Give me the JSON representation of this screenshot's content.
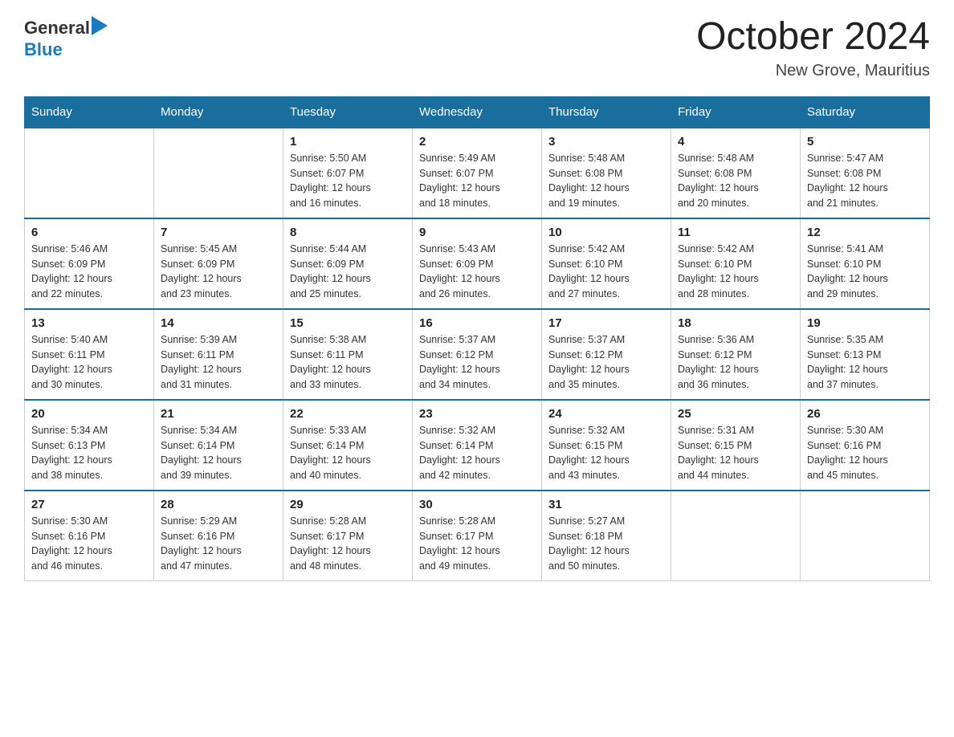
{
  "header": {
    "logo_general": "General",
    "logo_blue": "Blue",
    "month": "October 2024",
    "location": "New Grove, Mauritius"
  },
  "weekdays": [
    "Sunday",
    "Monday",
    "Tuesday",
    "Wednesday",
    "Thursday",
    "Friday",
    "Saturday"
  ],
  "weeks": [
    [
      {
        "day": "",
        "info": ""
      },
      {
        "day": "",
        "info": ""
      },
      {
        "day": "1",
        "info": "Sunrise: 5:50 AM\nSunset: 6:07 PM\nDaylight: 12 hours\nand 16 minutes."
      },
      {
        "day": "2",
        "info": "Sunrise: 5:49 AM\nSunset: 6:07 PM\nDaylight: 12 hours\nand 18 minutes."
      },
      {
        "day": "3",
        "info": "Sunrise: 5:48 AM\nSunset: 6:08 PM\nDaylight: 12 hours\nand 19 minutes."
      },
      {
        "day": "4",
        "info": "Sunrise: 5:48 AM\nSunset: 6:08 PM\nDaylight: 12 hours\nand 20 minutes."
      },
      {
        "day": "5",
        "info": "Sunrise: 5:47 AM\nSunset: 6:08 PM\nDaylight: 12 hours\nand 21 minutes."
      }
    ],
    [
      {
        "day": "6",
        "info": "Sunrise: 5:46 AM\nSunset: 6:09 PM\nDaylight: 12 hours\nand 22 minutes."
      },
      {
        "day": "7",
        "info": "Sunrise: 5:45 AM\nSunset: 6:09 PM\nDaylight: 12 hours\nand 23 minutes."
      },
      {
        "day": "8",
        "info": "Sunrise: 5:44 AM\nSunset: 6:09 PM\nDaylight: 12 hours\nand 25 minutes."
      },
      {
        "day": "9",
        "info": "Sunrise: 5:43 AM\nSunset: 6:09 PM\nDaylight: 12 hours\nand 26 minutes."
      },
      {
        "day": "10",
        "info": "Sunrise: 5:42 AM\nSunset: 6:10 PM\nDaylight: 12 hours\nand 27 minutes."
      },
      {
        "day": "11",
        "info": "Sunrise: 5:42 AM\nSunset: 6:10 PM\nDaylight: 12 hours\nand 28 minutes."
      },
      {
        "day": "12",
        "info": "Sunrise: 5:41 AM\nSunset: 6:10 PM\nDaylight: 12 hours\nand 29 minutes."
      }
    ],
    [
      {
        "day": "13",
        "info": "Sunrise: 5:40 AM\nSunset: 6:11 PM\nDaylight: 12 hours\nand 30 minutes."
      },
      {
        "day": "14",
        "info": "Sunrise: 5:39 AM\nSunset: 6:11 PM\nDaylight: 12 hours\nand 31 minutes."
      },
      {
        "day": "15",
        "info": "Sunrise: 5:38 AM\nSunset: 6:11 PM\nDaylight: 12 hours\nand 33 minutes."
      },
      {
        "day": "16",
        "info": "Sunrise: 5:37 AM\nSunset: 6:12 PM\nDaylight: 12 hours\nand 34 minutes."
      },
      {
        "day": "17",
        "info": "Sunrise: 5:37 AM\nSunset: 6:12 PM\nDaylight: 12 hours\nand 35 minutes."
      },
      {
        "day": "18",
        "info": "Sunrise: 5:36 AM\nSunset: 6:12 PM\nDaylight: 12 hours\nand 36 minutes."
      },
      {
        "day": "19",
        "info": "Sunrise: 5:35 AM\nSunset: 6:13 PM\nDaylight: 12 hours\nand 37 minutes."
      }
    ],
    [
      {
        "day": "20",
        "info": "Sunrise: 5:34 AM\nSunset: 6:13 PM\nDaylight: 12 hours\nand 38 minutes."
      },
      {
        "day": "21",
        "info": "Sunrise: 5:34 AM\nSunset: 6:14 PM\nDaylight: 12 hours\nand 39 minutes."
      },
      {
        "day": "22",
        "info": "Sunrise: 5:33 AM\nSunset: 6:14 PM\nDaylight: 12 hours\nand 40 minutes."
      },
      {
        "day": "23",
        "info": "Sunrise: 5:32 AM\nSunset: 6:14 PM\nDaylight: 12 hours\nand 42 minutes."
      },
      {
        "day": "24",
        "info": "Sunrise: 5:32 AM\nSunset: 6:15 PM\nDaylight: 12 hours\nand 43 minutes."
      },
      {
        "day": "25",
        "info": "Sunrise: 5:31 AM\nSunset: 6:15 PM\nDaylight: 12 hours\nand 44 minutes."
      },
      {
        "day": "26",
        "info": "Sunrise: 5:30 AM\nSunset: 6:16 PM\nDaylight: 12 hours\nand 45 minutes."
      }
    ],
    [
      {
        "day": "27",
        "info": "Sunrise: 5:30 AM\nSunset: 6:16 PM\nDaylight: 12 hours\nand 46 minutes."
      },
      {
        "day": "28",
        "info": "Sunrise: 5:29 AM\nSunset: 6:16 PM\nDaylight: 12 hours\nand 47 minutes."
      },
      {
        "day": "29",
        "info": "Sunrise: 5:28 AM\nSunset: 6:17 PM\nDaylight: 12 hours\nand 48 minutes."
      },
      {
        "day": "30",
        "info": "Sunrise: 5:28 AM\nSunset: 6:17 PM\nDaylight: 12 hours\nand 49 minutes."
      },
      {
        "day": "31",
        "info": "Sunrise: 5:27 AM\nSunset: 6:18 PM\nDaylight: 12 hours\nand 50 minutes."
      },
      {
        "day": "",
        "info": ""
      },
      {
        "day": "",
        "info": ""
      }
    ]
  ]
}
